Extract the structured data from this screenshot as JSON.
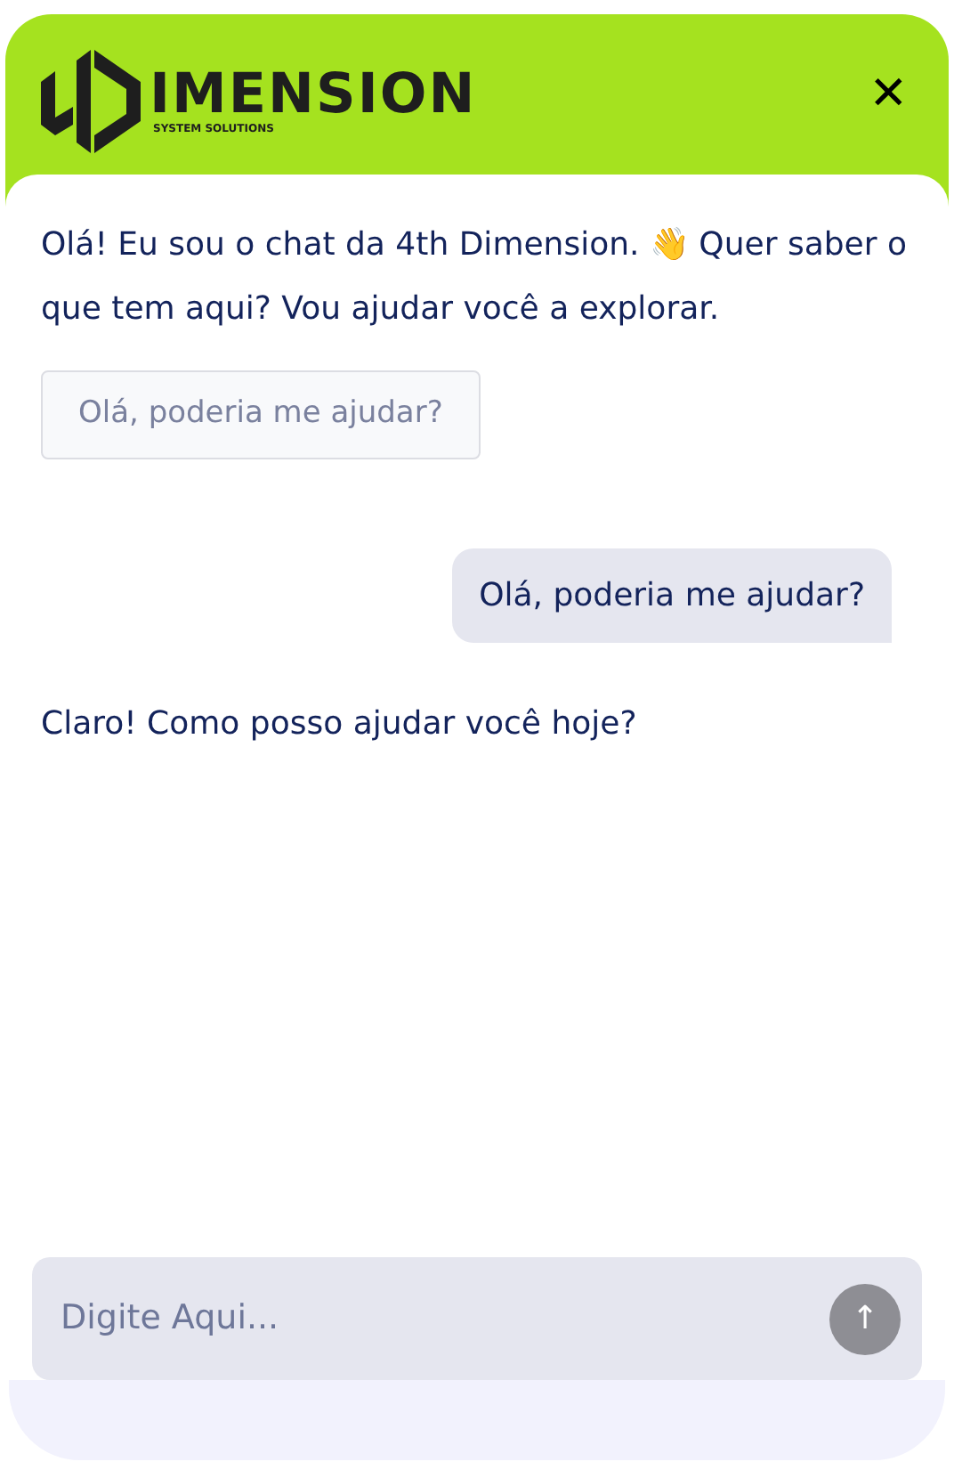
{
  "header": {
    "logo_text": "IMENSION",
    "logo_subtitle": "SYSTEM SOLUTIONS",
    "close": "✕"
  },
  "messages": [
    {
      "kind": "bot",
      "text": "Olá! Eu sou o chat da 4th Dimension. 👋 Quer saber o que tem aqui? Vou ajudar você a explorar."
    },
    {
      "kind": "suggestion",
      "text": "Olá, poderia me ajudar?"
    },
    {
      "kind": "user",
      "text": "Olá, poderia me ajudar?"
    },
    {
      "kind": "bot",
      "text": "Claro! Como posso ajudar você hoje?"
    }
  ],
  "composer": {
    "placeholder": "Digite Aqui...",
    "send": "↑"
  }
}
